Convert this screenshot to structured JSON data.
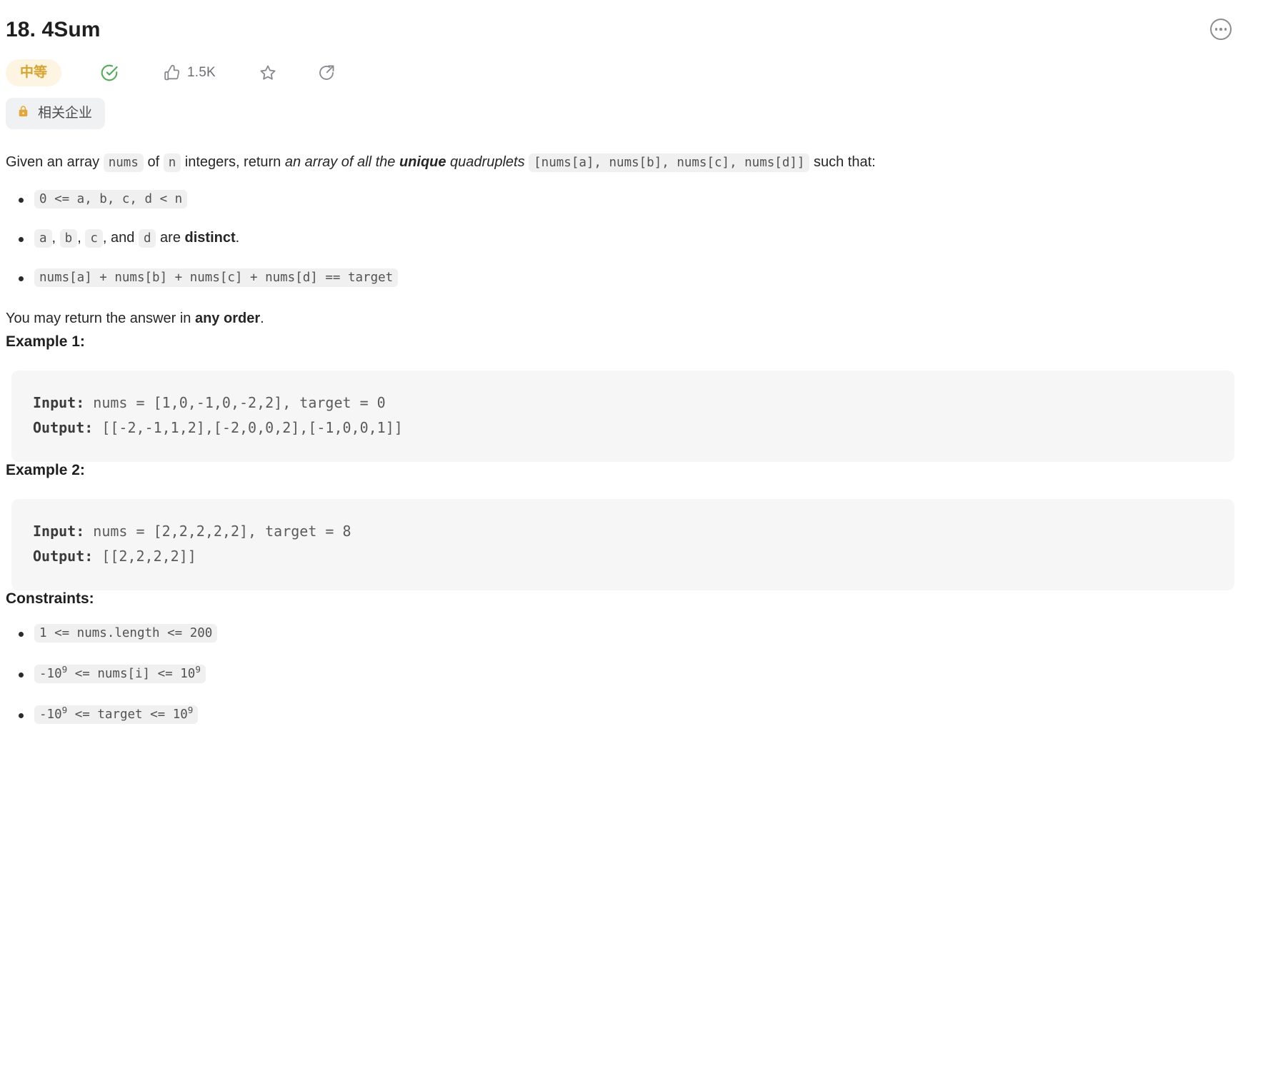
{
  "header": {
    "title": "18. 4Sum",
    "more_icon": "ellipsis-circle-icon",
    "difficulty": "中等",
    "solved_icon": "check-circle-icon",
    "like_icon": "thumbs-up-icon",
    "like_count": "1.5K",
    "favorite_icon": "star-icon",
    "share_icon": "share-arrow-icon",
    "company_tag": {
      "icon": "lock-icon",
      "label": "相关企业"
    }
  },
  "description": {
    "intro": {
      "t1": "Given an array ",
      "code_nums": "nums",
      "t2": " of ",
      "code_n": "n",
      "t3": " integers, return ",
      "em1": "an array of all the ",
      "em_bold": "unique",
      "em2": " quadruplets",
      "code_quads": "[nums[a], nums[b], nums[c], nums[d]]",
      "t4": " such that:"
    },
    "bullets": [
      {
        "code": "0 <= a, b, c, d < n"
      },
      {
        "parts": [
          {
            "type": "code",
            "text": "a"
          },
          {
            "type": "text",
            "text": ", "
          },
          {
            "type": "code",
            "text": "b"
          },
          {
            "type": "text",
            "text": ", "
          },
          {
            "type": "code",
            "text": "c"
          },
          {
            "type": "text",
            "text": ", and "
          },
          {
            "type": "code",
            "text": "d"
          },
          {
            "type": "text",
            "text": " are "
          },
          {
            "type": "bold",
            "text": "distinct"
          },
          {
            "type": "text",
            "text": "."
          }
        ]
      },
      {
        "code": "nums[a] + nums[b] + nums[c] + nums[d] == target"
      }
    ],
    "closing": {
      "t1": "You may return the answer in ",
      "bold": "any order",
      "t2": "."
    }
  },
  "examples": [
    {
      "heading": "Example 1:",
      "input_label": "Input:",
      "input_value": " nums = [1,0,-1,0,-2,2], target = 0",
      "output_label": "Output:",
      "output_value": " [[-2,-1,1,2],[-2,0,0,2],[-1,0,0,1]]"
    },
    {
      "heading": "Example 2:",
      "input_label": "Input:",
      "input_value": " nums = [2,2,2,2,2], target = 8",
      "output_label": "Output:",
      "output_value": " [[2,2,2,2]]"
    }
  ],
  "constraints": {
    "heading": "Constraints:",
    "items": [
      {
        "plain": "1 <= nums.length <= 200"
      },
      {
        "segments": [
          {
            "text": "-10"
          },
          {
            "sup": "9"
          },
          {
            "text": " <= nums[i] <= 10"
          },
          {
            "sup": "9"
          }
        ]
      },
      {
        "segments": [
          {
            "text": "-10"
          },
          {
            "sup": "9"
          },
          {
            "text": " <= target <= 10"
          },
          {
            "sup": "9"
          }
        ]
      }
    ]
  },
  "colors": {
    "difficulty_bg": "#fdf4e1",
    "difficulty_fg": "#d8a32a",
    "solved_green": "#4caf50",
    "lock_amber": "#e5a732",
    "code_bg": "#f6f6f6",
    "inline_code_bg": "#f0f0f0",
    "tag_bg": "#eff1f3"
  }
}
